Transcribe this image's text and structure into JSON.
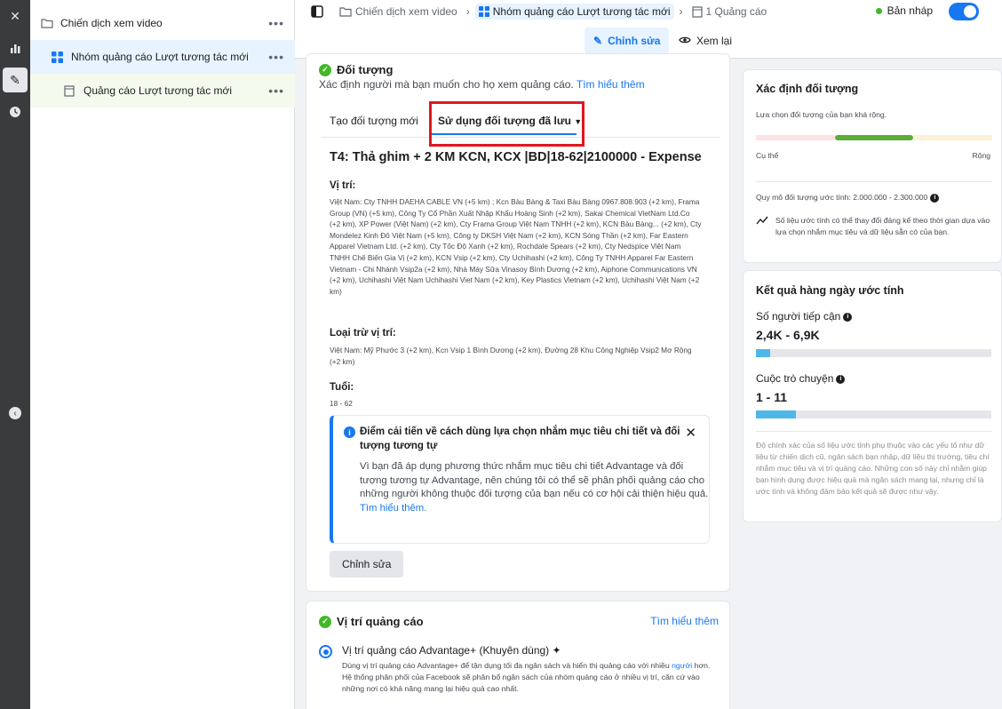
{
  "nav": {
    "campaign": "Chiến dịch xem video",
    "adset": "Nhóm quảng cáo Lượt tương tác mới",
    "ad": "Quảng cáo Lượt tương tác mới",
    "more": "•••"
  },
  "breadcrumb": {
    "campaign": "Chiến dịch xem video",
    "adset": "Nhóm quảng cáo Lượt tương tác mới",
    "ad": "1 Quảng cáo"
  },
  "status": {
    "draft": "Bản nháp",
    "toggle_on": true
  },
  "mode_tabs": {
    "edit": "Chỉnh sửa",
    "review": "Xem lại"
  },
  "audience": {
    "title": "Đối tượng",
    "subtitle": "Xác định người mà bạn muốn cho họ xem quảng cáo.",
    "learn_more": "Tìm hiểu thêm",
    "tab_new": "Tạo đối tượng mới",
    "tab_saved": "Sử dụng đối tượng đã lưu",
    "name": "T4: Thả ghim + 2 KM KCN, KCX |BD|18-62|2100000 - Expense",
    "location_label": "Vị trí:",
    "location_text": "Việt Nam: Cty TNHH DAEHA CABLE VN (+5 km) ; Kcn Bàu Bàng & Taxi Bàu Bàng 0967.808.903 (+2 km), Frama Group (VN) (+5 km), Công Ty Cổ Phần Xuất Nhập Khẩu Hoàng Sinh (+2 km), Sakai Chemical VietNam Ltd.Co (+2 km), XP Power (Việt Nam) (+2 km), Cty Frama Group Việt Nam TNHH (+2 km), KCN Bàu Bàng... (+2 km), Cty Mondelez Kinh Đô Việt Nam (+5 km), Công ty DKSH Việt Nam (+2 km), KCN Sóng Thần (+2 km), Far Eastern Apparel Vietnam Ltd. (+2 km), Cty Tốc Độ Xanh (+2 km), Rochdale Spears (+2 km), Cty Nedspice Việt Nam TNHH Chế Biến Gia Vị (+2 km), KCN Vsip (+2 km), Cty Uchihashi (+2 km), Công Ty TNHH Apparel Far Eastern Vietnam - Chi Nhánh Vsip2a (+2 km), Nhà Máy Sữa Vinasoy Bình Dương (+2 km), Aiphone Communications VN (+2 km), Uchihashi Việt Nam Uchihashi Viet Nam (+2 km), Key Plastics Vietnam (+2 km), Uchihashi Việt Nam (+2 km)",
    "exclude_label": "Loại trừ vị trí:",
    "exclude_text": "Việt Nam: Mỹ Phước 3 (+2 km), Kcn Vsip 1 Bình Dương (+2 km), Đường 28 Khu Công Nghiệp Vsip2 Mơ Rộng (+2 km)",
    "age_label": "Tuổi:",
    "age_text": "18 - 62",
    "notice_title": "Điểm cải tiến về cách dùng lựa chọn nhắm mục tiêu chi tiết và đối tượng tương tự",
    "notice_body": "Vì bạn đã áp dụng phương thức nhắm mục tiêu chi tiết Advantage và đối tượng tương tự Advantage, nên chúng tôi có thể sẽ phân phối quảng cáo cho những người không thuộc đối tượng của bạn nếu có cơ hội cải thiện hiệu quả.",
    "notice_link": "Tìm hiểu thêm.",
    "edit_button": "Chỉnh sửa"
  },
  "placement": {
    "title": "Vị trí quảng cáo",
    "learn_more": "Tìm hiểu thêm",
    "option_label": "Vị trí quảng cáo Advantage+ (Khuyên dùng)",
    "option_desc_1": "Dùng vị trí quảng cáo Advantage+ để tận dụng tối đa ngân sách và hiển thị quảng cáo với nhiều",
    "option_desc_link": "người",
    "option_desc_2": "hơn. Hệ thống phân phối của Facebook sẽ phân bổ ngân sách của nhóm quảng cáo ở nhiều vị trí, căn cứ vào những nơi có khả năng mang lại hiệu quả cao nhất."
  },
  "audience_definition": {
    "title": "Xác định đối tượng",
    "subtitle": "Lựa chọn đối tượng của bạn khá rộng.",
    "left_label": "Cụ thể",
    "right_label": "Rộng",
    "size_text": "Quy mô đối tượng ước tính: 2.000.000 - 2.300.000",
    "disclaimer": "Số liệu ước tính có thể thay đổi đáng kể theo thời gian dựa vào lựa chọn nhắm mục tiêu và dữ liệu sẵn có của bạn."
  },
  "daily_results": {
    "title": "Kết quả hàng ngày ước tính",
    "reach_label": "Số người tiếp cận",
    "reach_value": "2,4K - 6,9K",
    "reach_fill": 0.06,
    "conv_label": "Cuộc trò chuyện",
    "conv_value": "1 - 11",
    "conv_fill": 0.17,
    "note": "Độ chính xác của số liệu ước tính phụ thuộc vào các yếu tố như dữ liệu từ chiến dịch cũ, ngân sách bạn nhập, dữ liệu thị trường, tiêu chí nhắm mục tiêu và vị trí quảng cáo. Những con số này chỉ nhằm giúp bạn hình dung được hiệu quả mà ngân sách mang lại, nhưng chỉ là ước tính và không đảm bảo kết quả sẽ được như vậy."
  }
}
